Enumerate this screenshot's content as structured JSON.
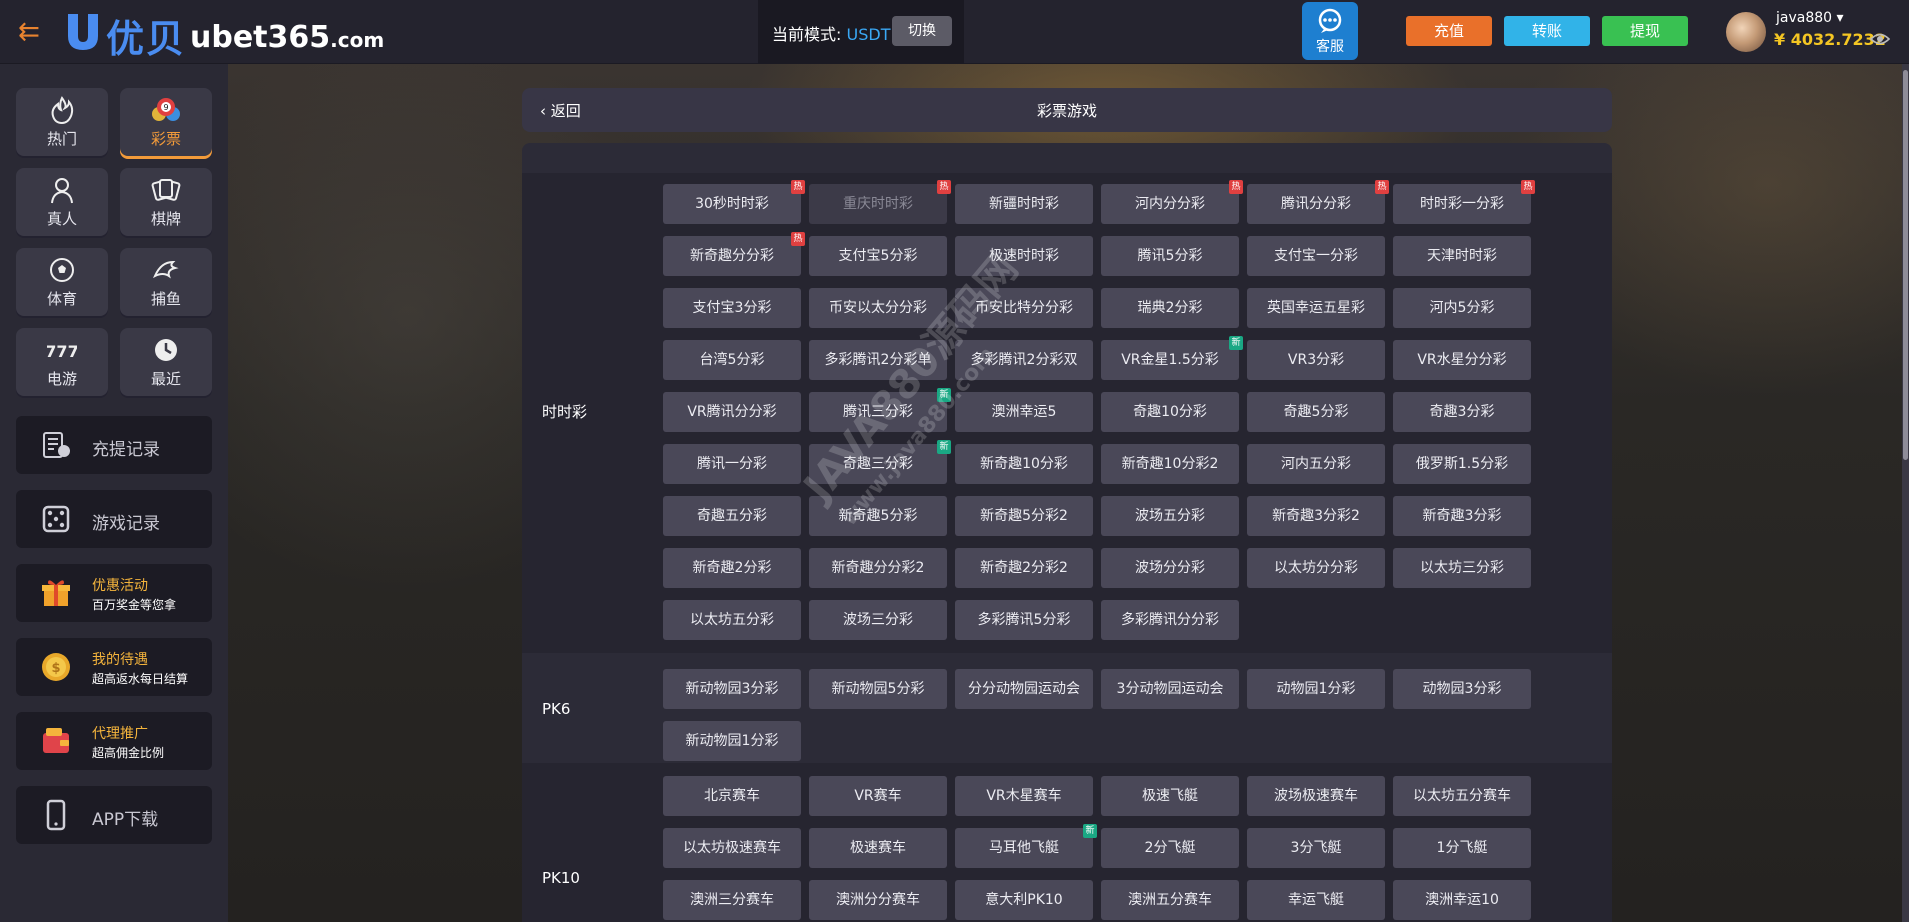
{
  "header": {
    "logo_cn": "优贝",
    "logo_en": "ubet365",
    "logo_tld": ".com",
    "mode_label": "当前模式:",
    "mode_value": "USDT",
    "mode_switch": "切换",
    "service_label": "客服",
    "recharge": "充值",
    "transfer": "转账",
    "withdraw": "提现",
    "username": "java880",
    "balance": "¥ 4032.7232"
  },
  "sidebar": {
    "categories": [
      {
        "label": "热门",
        "icon": "fire-icon"
      },
      {
        "label": "彩票",
        "icon": "lottery-ball-icon"
      },
      {
        "label": "真人",
        "icon": "live-dealer-icon"
      },
      {
        "label": "棋牌",
        "icon": "cards-icon"
      },
      {
        "label": "体育",
        "icon": "soccer-ball-icon"
      },
      {
        "label": "捕鱼",
        "icon": "fish-icon"
      },
      {
        "label": "电游",
        "icon": "slot-777-icon"
      },
      {
        "label": "最近",
        "icon": "clock-icon"
      }
    ],
    "panels": [
      {
        "title": "充提记录",
        "subtitle": "",
        "icon": "money-record-icon"
      },
      {
        "title": "游戏记录",
        "subtitle": "",
        "icon": "dice-icon"
      },
      {
        "title": "优惠活动",
        "subtitle": "百万奖金等您拿",
        "icon": "gift-icon"
      },
      {
        "title": "我的待遇",
        "subtitle": "超高返水每日结算",
        "icon": "gold-coin-icon"
      },
      {
        "title": "代理推广",
        "subtitle": "超高佣金比例",
        "icon": "wallet-icon"
      },
      {
        "title": "APP下载",
        "subtitle": "",
        "icon": "phone-icon"
      }
    ]
  },
  "main": {
    "back": "返回",
    "title": "彩票游戏",
    "watermark_line1": "JAVA880源码网",
    "watermark_line2": "www.java880.com",
    "sections": [
      {
        "label": "时时彩",
        "games": [
          {
            "name": "30秒时时彩",
            "badge": "热"
          },
          {
            "name": "重庆时时彩",
            "badge": "热",
            "dim": true
          },
          {
            "name": "新疆时时彩",
            "badge": ""
          },
          {
            "name": "河内分分彩",
            "badge": "热"
          },
          {
            "name": "腾讯分分彩",
            "badge": "热"
          },
          {
            "name": "时时彩一分彩",
            "badge": "热"
          },
          {
            "name": "新奇趣分分彩",
            "badge": "热"
          },
          {
            "name": "支付宝5分彩",
            "badge": ""
          },
          {
            "name": "极速时时彩",
            "badge": ""
          },
          {
            "name": "腾讯5分彩",
            "badge": ""
          },
          {
            "name": "支付宝一分彩",
            "badge": ""
          },
          {
            "name": "天津时时彩",
            "badge": ""
          },
          {
            "name": "支付宝3分彩",
            "badge": ""
          },
          {
            "name": "币安以太分分彩",
            "badge": ""
          },
          {
            "name": "币安比特分分彩",
            "badge": ""
          },
          {
            "name": "瑞典2分彩",
            "badge": ""
          },
          {
            "name": "英国幸运五星彩",
            "badge": ""
          },
          {
            "name": "河内5分彩",
            "badge": ""
          },
          {
            "name": "台湾5分彩",
            "badge": ""
          },
          {
            "name": "多彩腾讯2分彩单",
            "badge": ""
          },
          {
            "name": "多彩腾讯2分彩双",
            "badge": ""
          },
          {
            "name": "VR金星1.5分彩",
            "badge": "新"
          },
          {
            "name": "VR3分彩",
            "badge": ""
          },
          {
            "name": "VR水星分分彩",
            "badge": ""
          },
          {
            "name": "VR腾讯分分彩",
            "badge": ""
          },
          {
            "name": "腾讯三分彩",
            "badge": "新"
          },
          {
            "name": "澳洲幸运5",
            "badge": ""
          },
          {
            "name": "奇趣10分彩",
            "badge": ""
          },
          {
            "name": "奇趣5分彩",
            "badge": ""
          },
          {
            "name": "奇趣3分彩",
            "badge": ""
          },
          {
            "name": "腾讯一分彩",
            "badge": ""
          },
          {
            "name": "奇趣三分彩",
            "badge": "新"
          },
          {
            "name": "新奇趣10分彩",
            "badge": ""
          },
          {
            "name": "新奇趣10分彩2",
            "badge": ""
          },
          {
            "name": "河内五分彩",
            "badge": ""
          },
          {
            "name": "俄罗斯1.5分彩",
            "badge": ""
          },
          {
            "name": "奇趣五分彩",
            "badge": ""
          },
          {
            "name": "新奇趣5分彩",
            "badge": ""
          },
          {
            "name": "新奇趣5分彩2",
            "badge": ""
          },
          {
            "name": "波场五分彩",
            "badge": ""
          },
          {
            "name": "新奇趣3分彩2",
            "badge": ""
          },
          {
            "name": "新奇趣3分彩",
            "badge": ""
          },
          {
            "name": "新奇趣2分彩",
            "badge": ""
          },
          {
            "name": "新奇趣分分彩2",
            "badge": ""
          },
          {
            "name": "新奇趣2分彩2",
            "badge": ""
          },
          {
            "name": "波场分分彩",
            "badge": ""
          },
          {
            "name": "以太坊分分彩",
            "badge": ""
          },
          {
            "name": "以太坊三分彩",
            "badge": ""
          },
          {
            "name": "以太坊五分彩",
            "badge": ""
          },
          {
            "name": "波场三分彩",
            "badge": ""
          },
          {
            "name": "多彩腾讯5分彩",
            "badge": ""
          },
          {
            "name": "多彩腾讯分分彩",
            "badge": ""
          }
        ]
      },
      {
        "label": "PK6",
        "games": [
          {
            "name": "新动物园3分彩",
            "badge": ""
          },
          {
            "name": "新动物园5分彩",
            "badge": ""
          },
          {
            "name": "分分动物园运动会",
            "badge": ""
          },
          {
            "name": "3分动物园运动会",
            "badge": ""
          },
          {
            "name": "动物园1分彩",
            "badge": ""
          },
          {
            "name": "动物园3分彩",
            "badge": ""
          },
          {
            "name": "新动物园1分彩",
            "badge": ""
          }
        ]
      },
      {
        "label": "PK10",
        "games": [
          {
            "name": "北京赛车",
            "badge": ""
          },
          {
            "name": "VR赛车",
            "badge": ""
          },
          {
            "name": "VR木星赛车",
            "badge": ""
          },
          {
            "name": "极速飞艇",
            "badge": ""
          },
          {
            "name": "波场极速赛车",
            "badge": ""
          },
          {
            "name": "以太坊五分赛车",
            "badge": ""
          },
          {
            "name": "以太坊极速赛车",
            "badge": ""
          },
          {
            "name": "极速赛车",
            "badge": ""
          },
          {
            "name": "马耳他飞艇",
            "badge": "新"
          },
          {
            "name": "2分飞艇",
            "badge": ""
          },
          {
            "name": "3分飞艇",
            "badge": ""
          },
          {
            "name": "1分飞艇",
            "badge": ""
          },
          {
            "name": "澳洲三分赛车",
            "badge": ""
          },
          {
            "name": "澳洲分分赛车",
            "badge": ""
          },
          {
            "name": "意大利PK10",
            "badge": ""
          },
          {
            "name": "澳洲五分赛车",
            "badge": ""
          },
          {
            "name": "幸运飞艇",
            "badge": ""
          },
          {
            "name": "澳洲幸运10",
            "badge": ""
          }
        ]
      }
    ]
  }
}
